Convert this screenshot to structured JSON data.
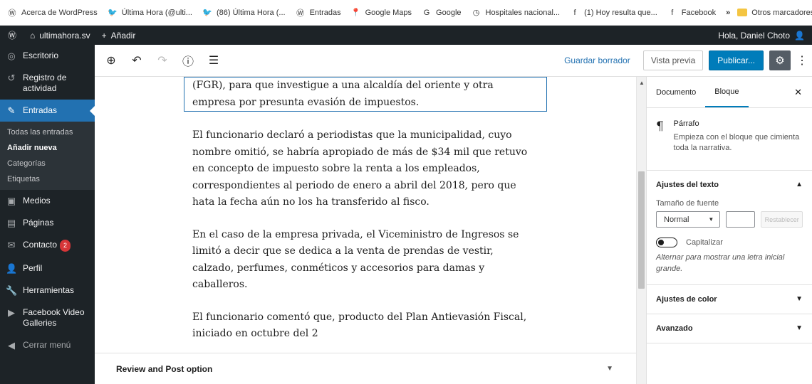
{
  "bookmarks": [
    {
      "icon": "wordpress-icon",
      "glyph": "Ⓦ",
      "label": "Acerca de WordPress"
    },
    {
      "icon": "twitter-icon",
      "glyph": "🐦",
      "label": "Última Hora (@ulti..."
    },
    {
      "icon": "twitter-icon",
      "glyph": "🐦",
      "label": "(86) Última Hora (..."
    },
    {
      "icon": "wordpress-icon",
      "glyph": "Ⓦ",
      "label": "Entradas"
    },
    {
      "icon": "map-pin-icon",
      "glyph": "📍",
      "label": "Google Maps"
    },
    {
      "icon": "google-icon",
      "glyph": "G",
      "label": "Google"
    },
    {
      "icon": "clock-icon",
      "glyph": "◷",
      "label": "Hospitales nacional..."
    },
    {
      "icon": "facebook-icon",
      "glyph": "f",
      "label": "(1) Hoy resulta que..."
    },
    {
      "icon": "facebook-icon",
      "glyph": "f",
      "label": "Facebook"
    }
  ],
  "bookmarks_more": "»",
  "bookmarks_other": "Otros marcadores",
  "adminbar": {
    "site_name": "ultimahora.sv",
    "add_new": "Añadir",
    "greeting": "Hola, Daniel Choto"
  },
  "sidebar": {
    "dashboard": "Escritorio",
    "activity": "Registro de actividad",
    "posts": "Entradas",
    "sub_all": "Todas las entradas",
    "sub_new": "Añadir nueva",
    "sub_categories": "Categorías",
    "sub_tags": "Etiquetas",
    "media": "Medios",
    "pages": "Páginas",
    "contact": "Contacto",
    "contact_badge": "2",
    "profile": "Perfil",
    "tools": "Herramientas",
    "facebook_galleries": "Facebook Video Galleries",
    "collapse": "Cerrar menú"
  },
  "toolbar": {
    "save_draft": "Guardar borrador",
    "preview": "Vista previa",
    "publish": "Publicar..."
  },
  "content": {
    "p1": "(FGR), para que investigue a una alcaldía del oriente y otra empresa por presunta evasión de impuestos.",
    "p2": "El funcionario declaró a periodistas que la municipalidad, cuyo nombre omitió, se habría apropiado de más de $34 mil que retuvo en concepto de impuesto sobre la renta a los empleados, correspondientes al periodo de enero a abril del 2018, pero que hata la fecha aún no los ha transferido al fisco.",
    "p3": "En el caso de la empresa privada, el Viceministro de Ingresos se limitó a decir que se dedica a la venta de prendas de vestir, calzado, perfumes, conméticos y accesorios para damas y caballeros.",
    "p4": "El funcionario comentó que, producto del Plan Antievasión Fiscal, iniciado en octubre del 2",
    "review_panel": "Review and Post option"
  },
  "settings": {
    "tab_document": "Documento",
    "tab_block": "Bloque",
    "block_name": "Párrafo",
    "block_desc": "Empieza con el bloque que cimienta toda la narrativa.",
    "text_settings": "Ajustes del texto",
    "font_size_label": "Tamaño de fuente",
    "font_size_value": "Normal",
    "reset": "Restablecer",
    "dropcap_label": "Capitalizar",
    "dropcap_help": "Alternar para mostrar una letra inicial grande.",
    "color_settings": "Ajustes de color",
    "advanced": "Avanzado"
  }
}
